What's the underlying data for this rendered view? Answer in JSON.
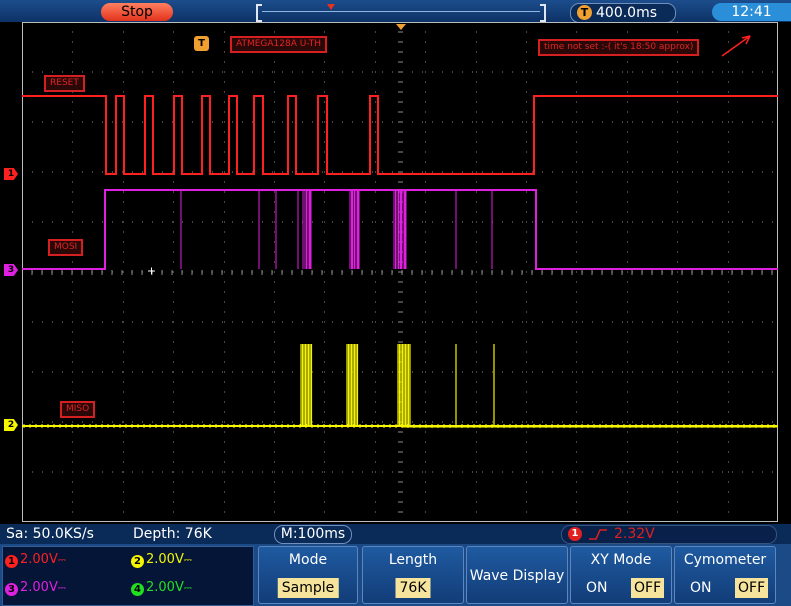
{
  "topbar": {
    "run_state": "Stop",
    "timebase": "400.0ms",
    "trigger_icon": "T",
    "clock": "12:41"
  },
  "screen": {
    "title": "ATMEGA128A U-TH",
    "note": "time not set :-( it's 18:50 approx)",
    "trigger_icon": "T",
    "trace_labels": {
      "reset": "RESET",
      "mosi": "MOSI",
      "miso": "MISO"
    },
    "channel_markers": {
      "ch1": "1",
      "ch3": "3",
      "ch2": "2"
    },
    "colors": {
      "ch1": "#ff2020",
      "ch2": "#f5f500",
      "ch3": "#e020e0",
      "ch4": "#20e020",
      "accent": "#f0a030",
      "grid": "#8c8c8c"
    }
  },
  "status": {
    "sample_rate": "Sa: 50.0KS/s",
    "depth": "Depth: 76K",
    "m_time": "M:100ms",
    "trigger_channel": "1",
    "trigger_level": "2.32V"
  },
  "channels": [
    {
      "num": "1",
      "scale": "2.00V",
      "color": "#ff2020"
    },
    {
      "num": "2",
      "scale": "2.00V",
      "color": "#f5f500"
    },
    {
      "num": "3",
      "scale": "2.00V",
      "color": "#e020e0"
    },
    {
      "num": "4",
      "scale": "2.00V",
      "color": "#20e020"
    }
  ],
  "menus": {
    "mode": {
      "title": "Mode",
      "value": "Sample"
    },
    "length": {
      "title": "Length",
      "value": "76K"
    },
    "wave_display": {
      "title": "Wave Display"
    },
    "xy_mode": {
      "title": "XY Mode",
      "on": "ON",
      "off": "OFF",
      "selected": "OFF"
    },
    "cymometer": {
      "title": "Cymometer",
      "on": "ON",
      "off": "OFF",
      "selected": "OFF"
    }
  }
}
